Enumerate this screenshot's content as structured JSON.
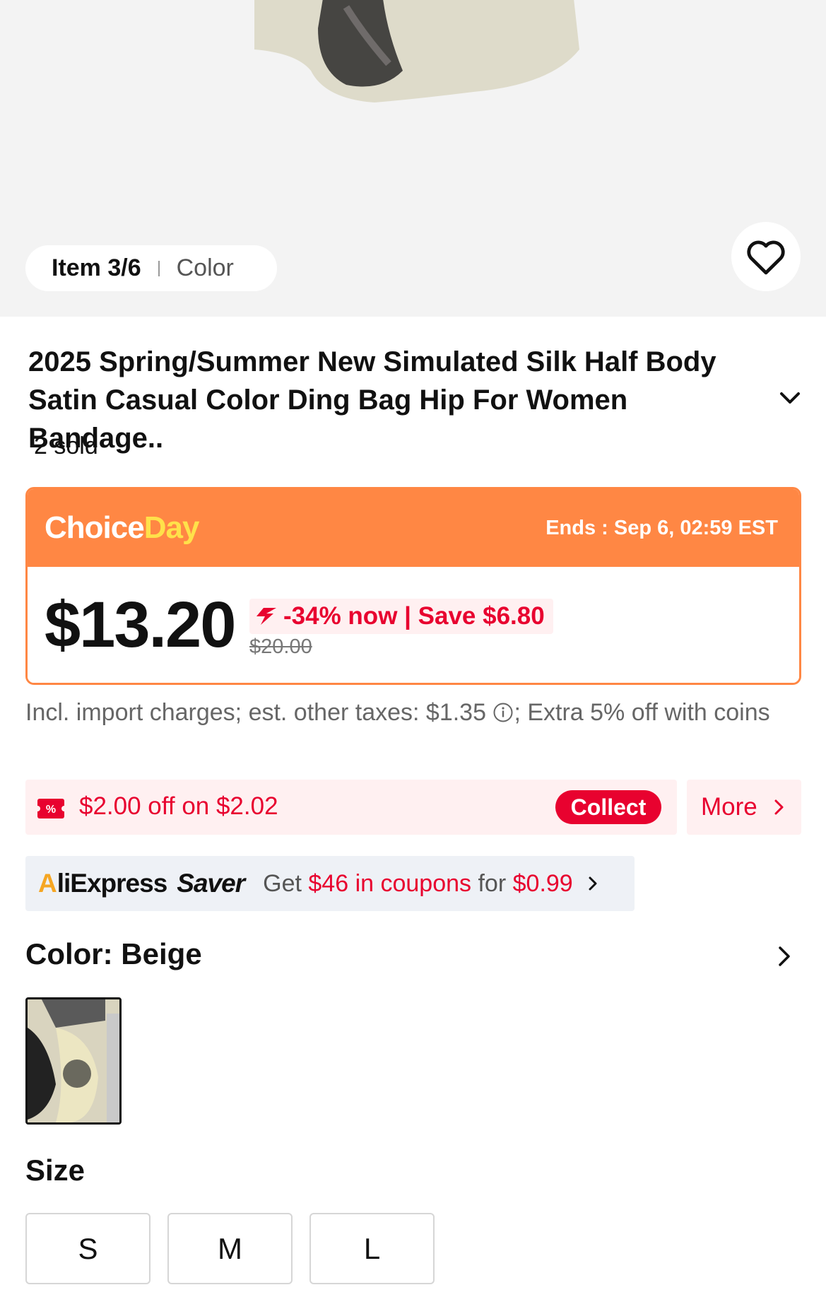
{
  "gallery": {
    "item_counter": "Item 3/6",
    "variant_label": "Color"
  },
  "product": {
    "title": "2025 Spring/Summer New Simulated Silk Half Body Satin Casual Color Ding Bag Hip For Women Bandage..",
    "sold": "2 sold"
  },
  "promo": {
    "brand_part1": "Choice",
    "brand_part2": "Day",
    "ends": "Ends : Sep 6, 02:59 EST",
    "price": "$13.20",
    "discount": "-34% now | Save $6.80",
    "original_price": "$20.00"
  },
  "tax_note": {
    "before_icon": "Incl. import charges; est. other taxes: $1.35",
    "after_icon": "; Extra 5% off with coins"
  },
  "coupon": {
    "text": "$2.00 off on $2.02",
    "collect_label": "Collect",
    "more_label": "More"
  },
  "saver": {
    "logo_main": "liExpress",
    "logo_saver": "aver",
    "text_prefix": "Get",
    "text_highlight_1": "$46 in coupons",
    "text_mid": "for",
    "text_highlight_2": "$0.99"
  },
  "color_section": {
    "title": "Color: Beige"
  },
  "size_section": {
    "title": "Size",
    "options": [
      "S",
      "M",
      "L"
    ]
  },
  "colors": {
    "accent_red": "#e8022f",
    "promo_orange": "#ff8744",
    "brand_yellow": "#ffe14a"
  },
  "icons": [
    "heart-icon",
    "chevron-down-icon",
    "flash-icon",
    "info-icon",
    "coupon-icon",
    "chevron-right-icon"
  ]
}
